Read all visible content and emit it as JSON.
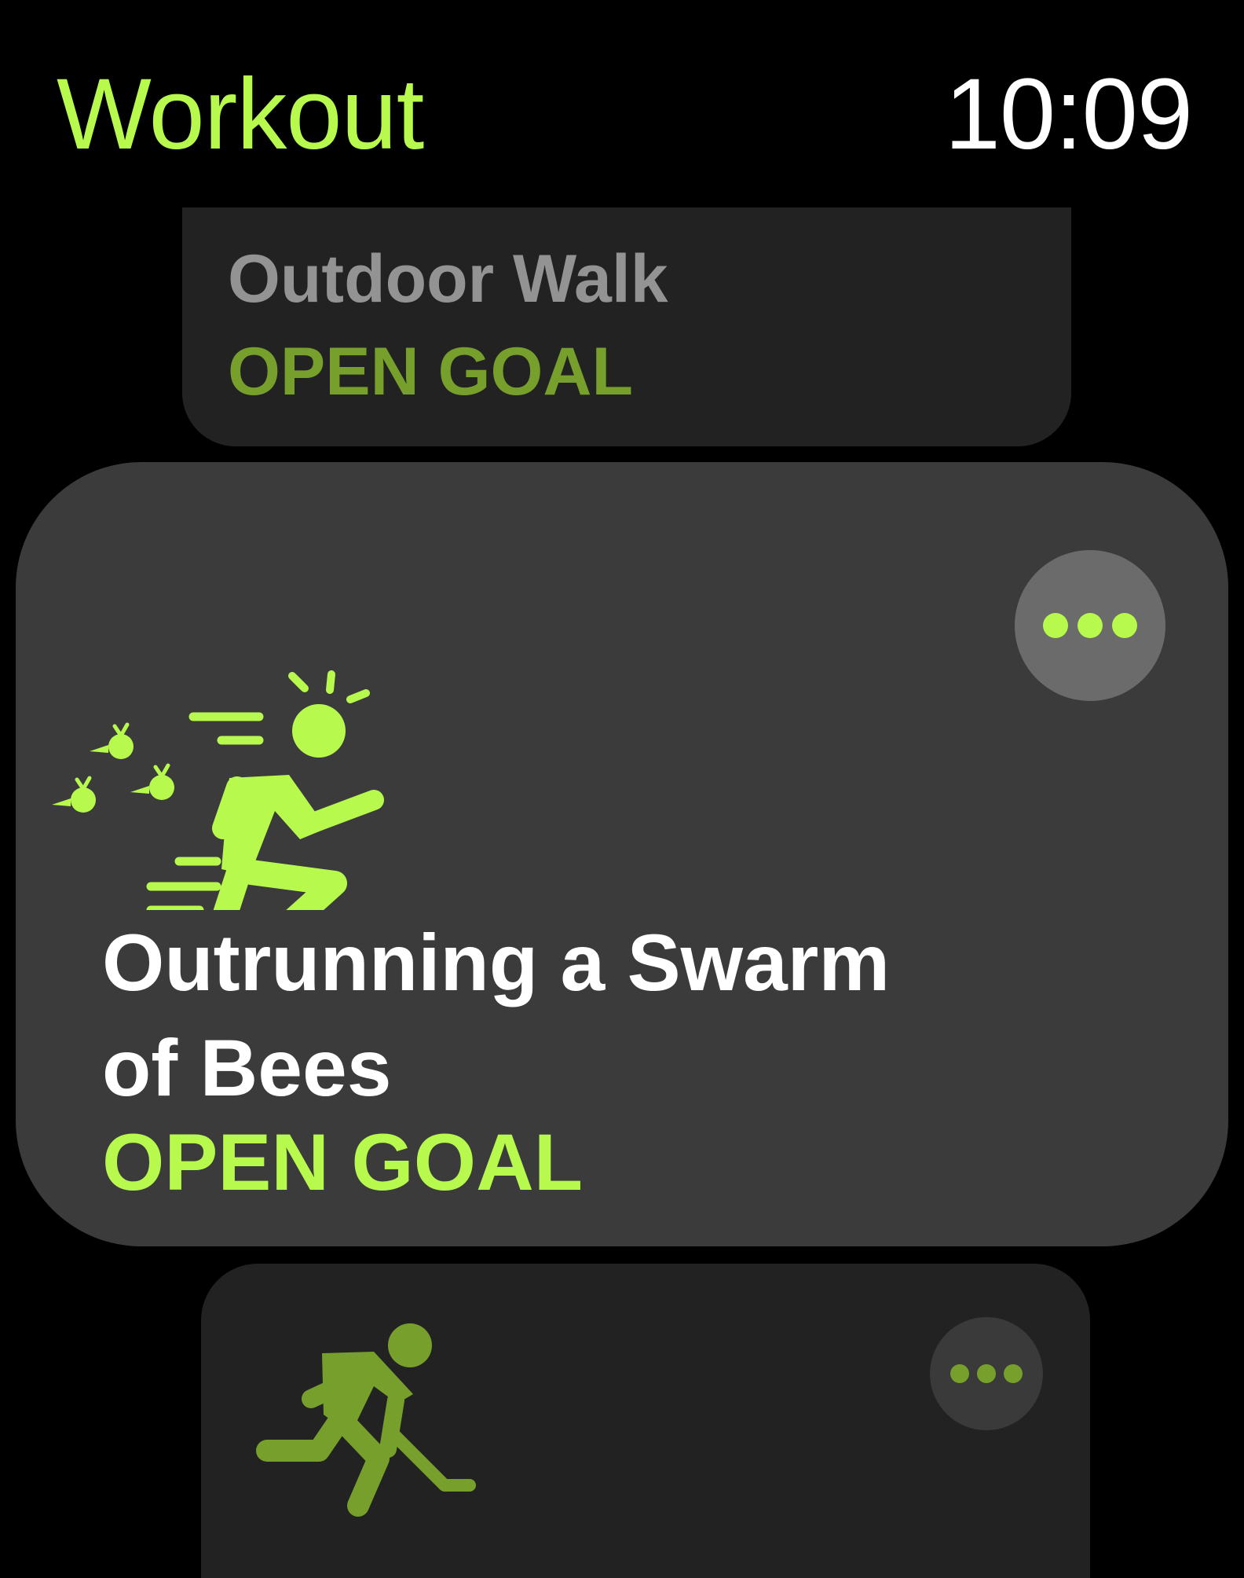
{
  "header": {
    "title": "Workout",
    "time": "10:09"
  },
  "workouts": [
    {
      "name": "Outdoor Walk",
      "goal": "OPEN GOAL",
      "icon": "walking-icon"
    },
    {
      "name": "Outrunning a Swarm of Bees",
      "goal": "OPEN GOAL",
      "icon": "running-from-bees-icon",
      "more_icon": "ellipsis-icon"
    },
    {
      "name": "",
      "goal": "",
      "icon": "hockey-player-icon",
      "more_icon": "ellipsis-icon"
    }
  ],
  "colors": {
    "background": "#000000",
    "accent": "#b8f94e",
    "accent_dim": "#76a02b",
    "title_text": "#ffffff",
    "dim_text": "#939393",
    "card_focused": "#3b3b3b",
    "card_dim": "#222222",
    "more_button_focused": "#6b6b6b",
    "more_button_dim": "#3a3a3a"
  }
}
